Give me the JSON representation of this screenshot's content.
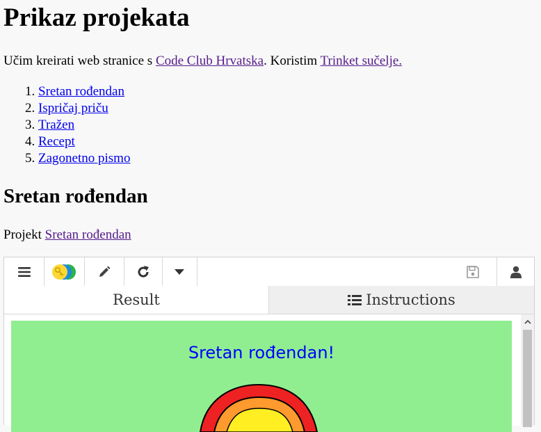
{
  "title": "Prikaz projekata",
  "intro": {
    "text_before": "Učim kreirati web stranice s ",
    "link1": "Code Club Hrvatska",
    "text_middle": ". Koristim ",
    "link2": "Trinket sučelje."
  },
  "projects_list": [
    "Sretan rođendan",
    "Ispričaj priču",
    "Tražen",
    "Recept",
    "Zagonetno pismo"
  ],
  "section": {
    "heading": "Sretan rođendan",
    "text_before": "Projekt ",
    "link": "Sretan rođendan"
  },
  "trinket": {
    "toolbar": {
      "icons": [
        "menu-icon",
        "trinket-logo-icon",
        "pencil-icon",
        "refresh-icon",
        "caret-down-icon",
        "save-icon",
        "user-icon"
      ]
    },
    "tabs": {
      "result": "Result",
      "instructions": "Instructions"
    },
    "canvas": {
      "text": "Sretan rođendan!",
      "background": "#90ee90",
      "text_color": "#0000ff"
    }
  }
}
